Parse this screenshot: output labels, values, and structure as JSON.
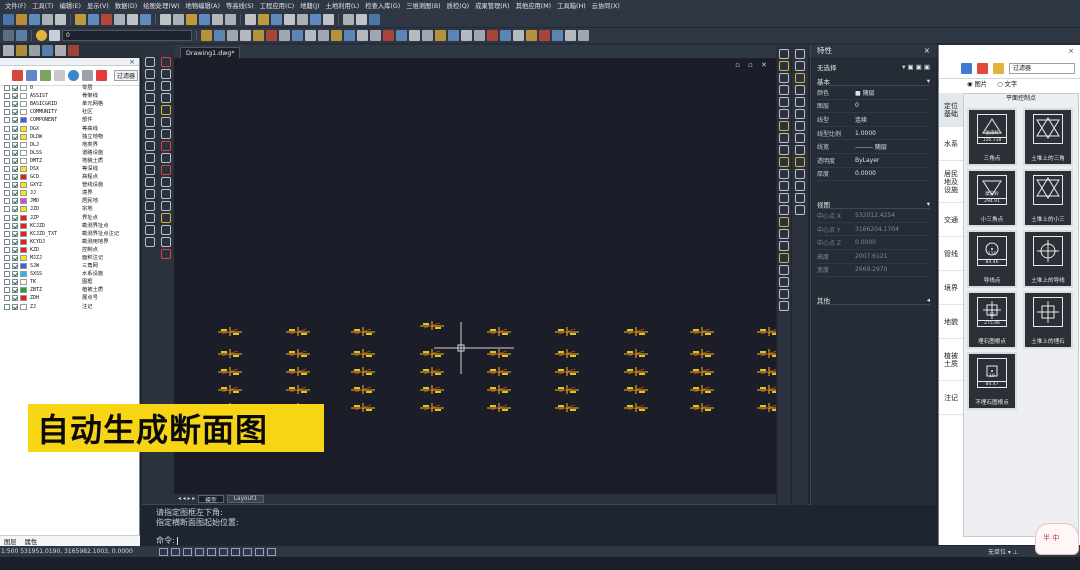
{
  "menu": [
    "文件(F)",
    "工具(T)",
    "编辑(E)",
    "显示(V)",
    "数据(D)",
    "绘图处理(W)",
    "地物编辑(A)",
    "等高线(S)",
    "工程应用(C)",
    "地籍(J)",
    "土地利用(L)",
    "检查入库(G)",
    "三维测图(B)",
    "质检(Q)",
    "成果管理(R)",
    "其他应用(M)",
    "工具箱(H)",
    "云协同(X)"
  ],
  "toolbar2": {
    "layer_combo": "0"
  },
  "layer_panel": {
    "filter_label": "过滤器",
    "tabs": [
      "图层",
      "属性"
    ],
    "layers": [
      {
        "name": "0",
        "desc": "零层",
        "color": "#ffffff"
      },
      {
        "name": "ASSIST",
        "desc": "骨架线",
        "color": "#ffffff"
      },
      {
        "name": "BASICGRID",
        "desc": "单元网格",
        "color": "#ffffff"
      },
      {
        "name": "COMMUNITY",
        "desc": "社区",
        "color": "#ffffff"
      },
      {
        "name": "COMPONENT",
        "desc": "部件",
        "color": "#2f66e6"
      },
      {
        "name": "DGX",
        "desc": "等高线",
        "color": "#f5e51c"
      },
      {
        "name": "DLDW",
        "desc": "独立地物",
        "color": "#f5e51c"
      },
      {
        "name": "DLJ",
        "desc": "地类界",
        "color": "#ffffff"
      },
      {
        "name": "DLSS",
        "desc": "道路设施",
        "color": "#ffffff"
      },
      {
        "name": "DMTZ",
        "desc": "地貌土质",
        "color": "#ffffff"
      },
      {
        "name": "DSX",
        "desc": "等深线",
        "color": "#f5e51c"
      },
      {
        "name": "GCD",
        "desc": "高程点",
        "color": "#e02020"
      },
      {
        "name": "GXYZ",
        "desc": "管线设施",
        "color": "#f5e51c"
      },
      {
        "name": "JJ",
        "desc": "境界",
        "color": "#f5e51c"
      },
      {
        "name": "JMD",
        "desc": "居民地",
        "color": "#e040e0"
      },
      {
        "name": "JZD",
        "desc": "宗地",
        "color": "#f5e51c"
      },
      {
        "name": "JZP",
        "desc": "界址点",
        "color": "#e02020"
      },
      {
        "name": "KCJZD",
        "desc": "勘测界址点",
        "color": "#e02020"
      },
      {
        "name": "KCJZD_TXT",
        "desc": "勘测界址点注记",
        "color": "#e02020"
      },
      {
        "name": "KCYDJ",
        "desc": "勘测用地界",
        "color": "#e02020"
      },
      {
        "name": "KZD",
        "desc": "控制点",
        "color": "#e02020"
      },
      {
        "name": "MJZJ",
        "desc": "面积注记",
        "color": "#f5e51c"
      },
      {
        "name": "SJW",
        "desc": "三角网",
        "color": "#2f66e6"
      },
      {
        "name": "SXSS",
        "desc": "水系设施",
        "color": "#2bb8e8"
      },
      {
        "name": "TK",
        "desc": "图框",
        "color": "#ffffff"
      },
      {
        "name": "ZBTZ",
        "desc": "植被土质",
        "color": "#20a040"
      },
      {
        "name": "ZDH",
        "desc": "展点号",
        "color": "#e02020"
      },
      {
        "name": "ZJ",
        "desc": "注记",
        "color": "#ffffff"
      }
    ]
  },
  "document": {
    "tab_title": "Drawing1.dwg*",
    "window_controls": "▫ ▫ ✕"
  },
  "layout_tabs": [
    "模型",
    "Layout1"
  ],
  "banner_text": "自动生成断面图",
  "command": {
    "history": [
      "请指定图框左下角:",
      "指定横断面图起始位置:"
    ],
    "prompt": "命令:"
  },
  "properties": {
    "title": "特性",
    "selection": "无选择",
    "sections": {
      "basic": "基本",
      "view": "视图",
      "other": "其他"
    },
    "basic_rows": [
      {
        "k": "颜色",
        "v": "■ 随层"
      },
      {
        "k": "图层",
        "v": "0"
      },
      {
        "k": "线型",
        "v": "连续"
      },
      {
        "k": "线型比例",
        "v": "1.0000"
      },
      {
        "k": "线宽",
        "v": "——— 随层"
      },
      {
        "k": "透明度",
        "v": "ByLayer"
      },
      {
        "k": "厚度",
        "v": "0.0000"
      }
    ],
    "view_rows": [
      {
        "k": "中心点 X",
        "v": "532012.4254"
      },
      {
        "k": "中心点 Y",
        "v": "3166204.1704"
      },
      {
        "k": "中心点 Z",
        "v": "0.0000"
      },
      {
        "k": "高度",
        "v": "2007.6121"
      },
      {
        "k": "宽度",
        "v": "2669.2970"
      }
    ]
  },
  "symbol_library": {
    "filter_label": "过滤器",
    "radio_image": "图片",
    "radio_text": "文字",
    "grid_title": "平面控制点",
    "categories": [
      "定位基础",
      "水系",
      "居民地及设施",
      "交通",
      "管线",
      "境界",
      "地貌",
      "植被土质",
      "注记"
    ],
    "symbols": [
      {
        "caption": "三角点",
        "top": "张湾岭",
        "bottom": "156.718",
        "shape": "triangle"
      },
      {
        "caption": "土堆上的三角",
        "top": "",
        "bottom": "",
        "shape": "triangle-star"
      },
      {
        "caption": "小三角点",
        "top": "摩天岭",
        "bottom": "294.91",
        "shape": "triangle-down"
      },
      {
        "caption": "土堆上的小三",
        "top": "",
        "bottom": "",
        "shape": "triangle-down-star"
      },
      {
        "caption": "导线点",
        "top": "116",
        "bottom": "84.46",
        "shape": "circle"
      },
      {
        "caption": "土堆上的导线",
        "top": "",
        "bottom": "",
        "shape": "circle-cross"
      },
      {
        "caption": "埋石图根点",
        "top": "12",
        "bottom": "275.46",
        "shape": "square-cross"
      },
      {
        "caption": "土堆上的埋石",
        "top": "",
        "bottom": "",
        "shape": "square-cross-2"
      },
      {
        "caption": "不埋石图根点",
        "top": "19",
        "bottom": "84.47",
        "shape": "square-dot"
      }
    ]
  },
  "status": {
    "coords": "1:500  531951.0190, 3165982.1003, 0.0000",
    "right": "无单位 ▾ ⊥"
  },
  "mascot_text": "半 中"
}
